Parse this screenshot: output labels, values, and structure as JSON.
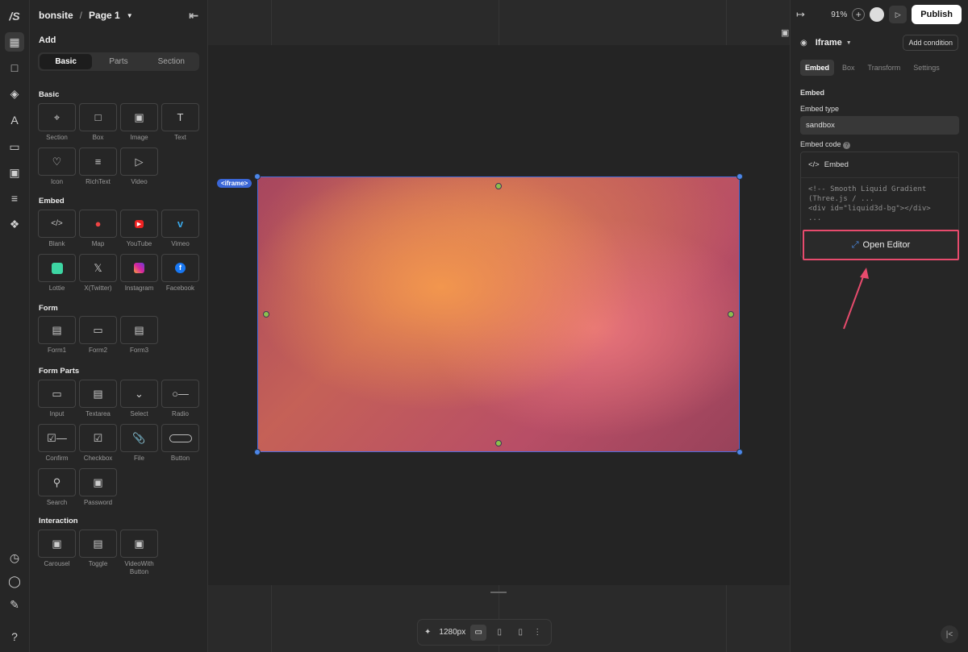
{
  "app": {
    "logo": "/S",
    "site": "bonsite",
    "page": "Page 1"
  },
  "rail": {
    "icons": [
      "add-elements-icon",
      "pages-icon",
      "layers-icon",
      "typography-icon",
      "folder-icon",
      "media-icon",
      "cms-icon",
      "components-icon"
    ],
    "bottom_icons": [
      "history-icon",
      "comments-icon",
      "pen-icon",
      "help-icon"
    ]
  },
  "left": {
    "add_title": "Add",
    "tabs": [
      "Basic",
      "Parts",
      "Section"
    ],
    "sections": [
      {
        "title": "Basic",
        "items": [
          "Section",
          "Box",
          "Image",
          "Text",
          "Icon",
          "RichText",
          "Video"
        ]
      },
      {
        "title": "Embed",
        "items": [
          "Blank",
          "Map",
          "YouTube",
          "Vimeo",
          "Lottie",
          "X(Twitter)",
          "Instagram",
          "Facebook"
        ]
      },
      {
        "title": "Form",
        "items": [
          "Form1",
          "Form2",
          "Form3"
        ]
      },
      {
        "title": "Form Parts",
        "items": [
          "Input",
          "Textarea",
          "Select",
          "Radio",
          "Confirm",
          "Checkbox",
          "File",
          "Button",
          "Search",
          "Password"
        ]
      },
      {
        "title": "Interaction",
        "items": [
          "Carousel",
          "Toggle",
          "VideoWith Button"
        ]
      }
    ]
  },
  "canvas": {
    "selected_tag": "<iframe>",
    "width_label": "1280px"
  },
  "right": {
    "zoom": "91%",
    "publish": "Publish",
    "element": "Iframe",
    "add_condition": "Add condition",
    "tabs": [
      "Embed",
      "Box",
      "Transform",
      "Settings"
    ],
    "embed_heading": "Embed",
    "embed_type_label": "Embed type",
    "embed_type_value": "sandbox",
    "embed_code_label": "Embed code",
    "code_header": "Embed",
    "code_lines": "<!-- Smooth Liquid Gradient\n(Three.js / ...\n<div id=\"liquid3d-bg\"></div>\n...",
    "open_editor": "Open Editor"
  },
  "colors": {
    "accent": "#4b6bdc",
    "highlight": "#e74b6d"
  }
}
